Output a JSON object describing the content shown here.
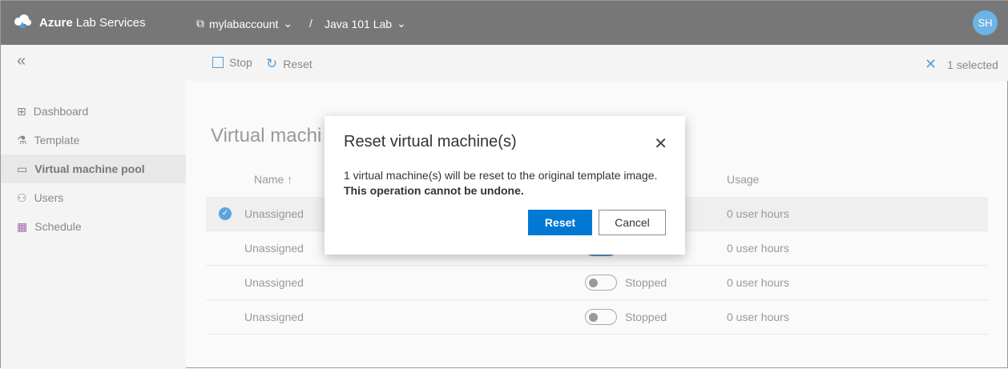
{
  "header": {
    "brand_bold": "Azure",
    "brand_rest": "Lab Services",
    "account": "mylabaccount",
    "separator": "/",
    "lab": "Java 101 Lab",
    "avatar": "SH"
  },
  "commandbar": {
    "stop": "Stop",
    "reset": "Reset",
    "selected": "1 selected"
  },
  "sidebar": {
    "items": [
      {
        "label": "Dashboard",
        "icon": "dashboard-icon"
      },
      {
        "label": "Template",
        "icon": "flask-icon"
      },
      {
        "label": "Virtual machine pool",
        "icon": "monitor-icon",
        "selected": true
      },
      {
        "label": "Users",
        "icon": "users-icon"
      },
      {
        "label": "Schedule",
        "icon": "calendar-icon"
      }
    ]
  },
  "main": {
    "title": "Virtual machi",
    "columns": {
      "name": "Name ↑",
      "usage": "Usage"
    },
    "rows": [
      {
        "name": "Unassigned",
        "usage": "0 user hours",
        "selected": true
      },
      {
        "name": "Unassigned",
        "usage": "0 user hours",
        "toggle_on": true
      },
      {
        "name": "Unassigned",
        "status": "Stopped",
        "usage": "0 user hours"
      },
      {
        "name": "Unassigned",
        "status": "Stopped",
        "usage": "0 user hours"
      }
    ]
  },
  "dialog": {
    "title": "Reset virtual machine(s)",
    "message": "1 virtual machine(s) will be reset to the original template image.",
    "warning": "This operation cannot be undone.",
    "confirm": "Reset",
    "cancel": "Cancel"
  },
  "colors": {
    "accent": "#0078d4",
    "header": "#777777"
  }
}
